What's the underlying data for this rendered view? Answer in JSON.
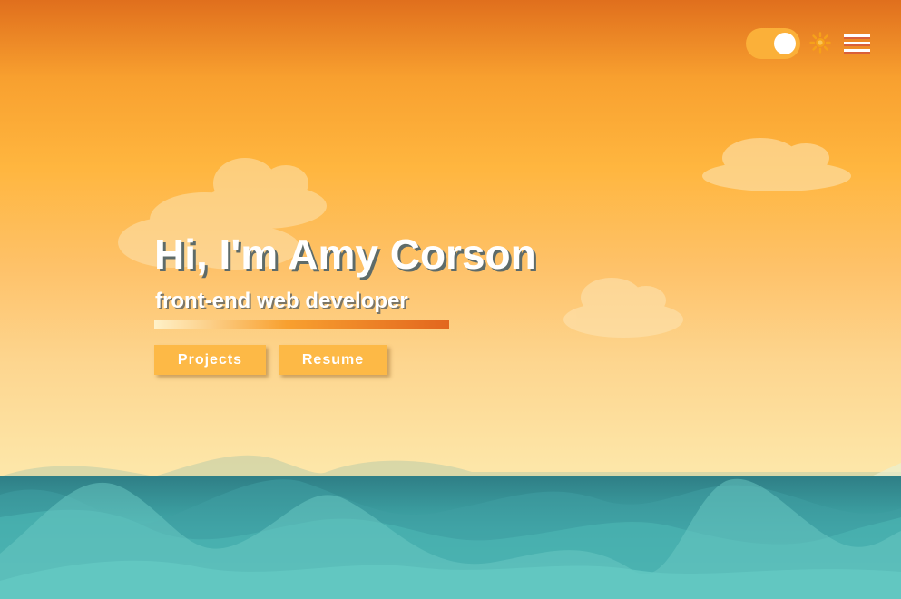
{
  "header": {
    "theme_toggle": {
      "state": "on",
      "icon": "sun-icon"
    },
    "menu_icon": "hamburger-menu-icon"
  },
  "hero": {
    "title": "Hi, I'm Amy Corson",
    "subtitle": "front-end web developer",
    "buttons": {
      "projects": "Projects",
      "resume": "Resume"
    }
  },
  "colors": {
    "sky_top": "#e06f1d",
    "sky_mid": "#ffb63f",
    "sky_bottom": "#fde8ab",
    "button": "#fdb946",
    "sea": "#4fbdb8"
  }
}
